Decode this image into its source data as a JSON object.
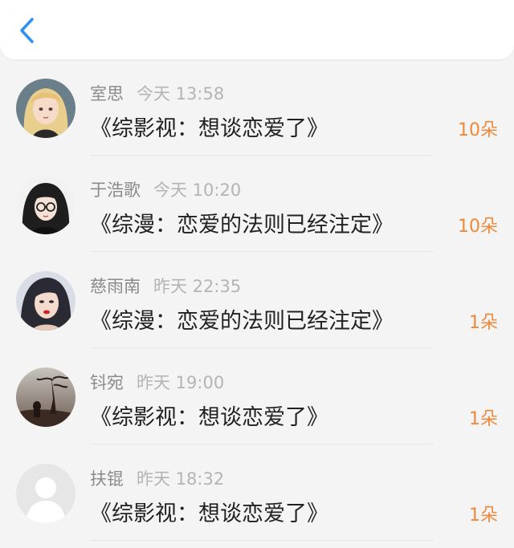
{
  "header": {
    "back_icon": "chevron-left-icon",
    "accent": "#2d8ff0"
  },
  "messages": [
    {
      "name": "室思",
      "time": "今天 13:58",
      "title": "《综影视：想谈恋爱了》",
      "count": "10朵",
      "avatar_icon": "avatar-girl-blonde"
    },
    {
      "name": "于浩歌",
      "time": "今天 10:20",
      "title": "《综漫：恋爱的法则已经注定》",
      "count": "10朵",
      "avatar_icon": "avatar-girl-glasses"
    },
    {
      "name": "慈雨南",
      "time": "昨天 22:35",
      "title": "《综漫：恋爱的法则已经注定》",
      "count": "1朵",
      "avatar_icon": "avatar-woman-portrait"
    },
    {
      "name": "钭宛",
      "time": "昨天 19:00",
      "title": "《综影视：想谈恋爱了》",
      "count": "1朵",
      "avatar_icon": "avatar-silhouette-tree"
    },
    {
      "name": "扶锟",
      "time": "昨天 18:32",
      "title": "《综影视：想谈恋爱了》",
      "count": "1朵",
      "avatar_icon": "avatar-default"
    }
  ],
  "colors": {
    "count": "#f0883a",
    "name": "#8a8a8a",
    "time": "#b4b4b4",
    "title": "#222222"
  }
}
